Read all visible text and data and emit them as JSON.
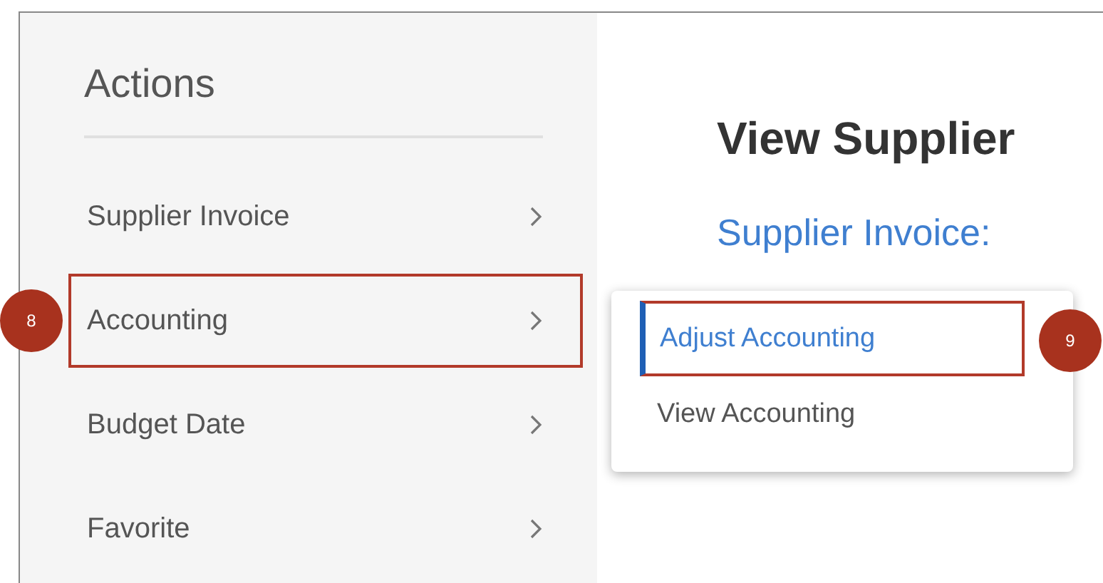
{
  "actions_panel": {
    "title": "Actions",
    "items": [
      {
        "label": "Supplier Invoice",
        "highlighted": false
      },
      {
        "label": "Accounting",
        "highlighted": true,
        "callout": "8"
      },
      {
        "label": "Budget Date",
        "highlighted": false
      },
      {
        "label": "Favorite",
        "highlighted": false
      }
    ]
  },
  "main": {
    "title": "View Supplier",
    "subtitle": "Supplier Invoice:"
  },
  "submenu": {
    "items": [
      {
        "label": "Adjust Accounting",
        "selected": true,
        "highlighted": true,
        "callout": "9"
      },
      {
        "label": "View Accounting",
        "selected": false,
        "highlighted": false
      }
    ]
  }
}
